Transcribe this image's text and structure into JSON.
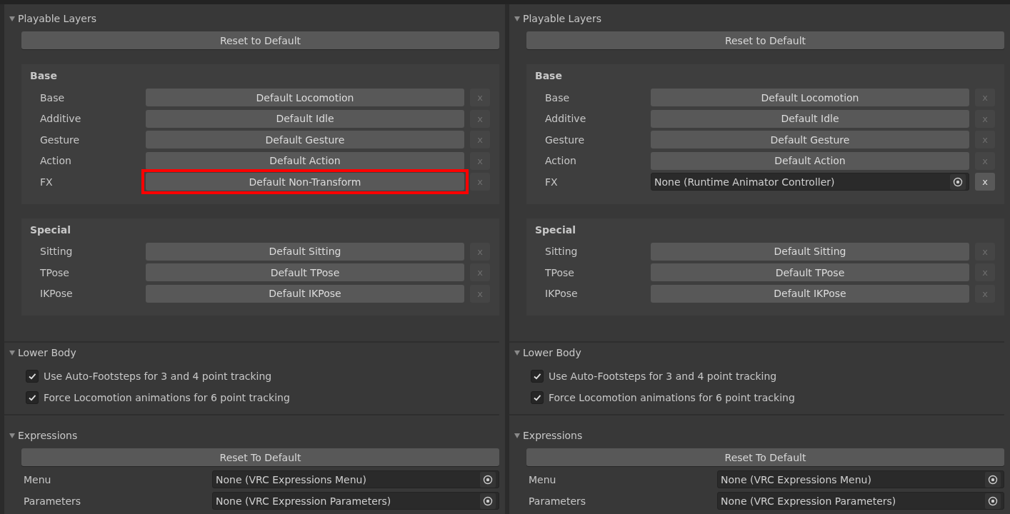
{
  "panels": [
    {
      "playable_layers": {
        "title": "Playable Layers",
        "expanded": true,
        "reset_button": "Reset to Default",
        "groups": [
          {
            "title": "Base",
            "layers": [
              {
                "label": "Base",
                "kind": "default",
                "value": "Default Locomotion",
                "clear_button": "x",
                "clear_enabled": false,
                "highlighted": false
              },
              {
                "label": "Additive",
                "kind": "default",
                "value": "Default Idle",
                "clear_button": "x",
                "clear_enabled": false,
                "highlighted": false
              },
              {
                "label": "Gesture",
                "kind": "default",
                "value": "Default Gesture",
                "clear_button": "x",
                "clear_enabled": false,
                "highlighted": false
              },
              {
                "label": "Action",
                "kind": "default",
                "value": "Default Action",
                "clear_button": "x",
                "clear_enabled": false,
                "highlighted": false
              },
              {
                "label": "FX",
                "kind": "default",
                "value": "Default Non-Transform",
                "clear_button": "x",
                "clear_enabled": false,
                "highlighted": true
              }
            ]
          },
          {
            "title": "Special",
            "layers": [
              {
                "label": "Sitting",
                "kind": "default",
                "value": "Default Sitting",
                "clear_button": "x",
                "clear_enabled": false,
                "highlighted": false
              },
              {
                "label": "TPose",
                "kind": "default",
                "value": "Default TPose",
                "clear_button": "x",
                "clear_enabled": false,
                "highlighted": false
              },
              {
                "label": "IKPose",
                "kind": "default",
                "value": "Default IKPose",
                "clear_button": "x",
                "clear_enabled": false,
                "highlighted": false
              }
            ]
          }
        ]
      },
      "lower_body": {
        "title": "Lower Body",
        "expanded": true,
        "options": [
          {
            "label": "Use Auto-Footsteps for 3 and 4 point tracking",
            "checked": true
          },
          {
            "label": "Force Locomotion animations for 6 point tracking",
            "checked": true
          }
        ]
      },
      "expressions": {
        "title": "Expressions",
        "expanded": true,
        "reset_button": "Reset To Default",
        "fields": [
          {
            "label": "Menu",
            "value": "None (VRC Expressions Menu)"
          },
          {
            "label": "Parameters",
            "value": "None (VRC Expression Parameters)"
          }
        ]
      }
    },
    {
      "playable_layers": {
        "title": "Playable Layers",
        "expanded": true,
        "reset_button": "Reset to Default",
        "groups": [
          {
            "title": "Base",
            "layers": [
              {
                "label": "Base",
                "kind": "default",
                "value": "Default Locomotion",
                "clear_button": "x",
                "clear_enabled": false,
                "highlighted": false
              },
              {
                "label": "Additive",
                "kind": "default",
                "value": "Default Idle",
                "clear_button": "x",
                "clear_enabled": false,
                "highlighted": false
              },
              {
                "label": "Gesture",
                "kind": "default",
                "value": "Default Gesture",
                "clear_button": "x",
                "clear_enabled": false,
                "highlighted": false
              },
              {
                "label": "Action",
                "kind": "default",
                "value": "Default Action",
                "clear_button": "x",
                "clear_enabled": false,
                "highlighted": false
              },
              {
                "label": "FX",
                "kind": "object",
                "value": "None (Runtime Animator Controller)",
                "clear_button": "x",
                "clear_enabled": true,
                "highlighted": false
              }
            ]
          },
          {
            "title": "Special",
            "layers": [
              {
                "label": "Sitting",
                "kind": "default",
                "value": "Default Sitting",
                "clear_button": "x",
                "clear_enabled": false,
                "highlighted": false
              },
              {
                "label": "TPose",
                "kind": "default",
                "value": "Default TPose",
                "clear_button": "x",
                "clear_enabled": false,
                "highlighted": false
              },
              {
                "label": "IKPose",
                "kind": "default",
                "value": "Default IKPose",
                "clear_button": "x",
                "clear_enabled": false,
                "highlighted": false
              }
            ]
          }
        ]
      },
      "lower_body": {
        "title": "Lower Body",
        "expanded": true,
        "options": [
          {
            "label": "Use Auto-Footsteps for 3 and 4 point tracking",
            "checked": true
          },
          {
            "label": "Force Locomotion animations for 6 point tracking",
            "checked": true
          }
        ]
      },
      "expressions": {
        "title": "Expressions",
        "expanded": true,
        "reset_button": "Reset To Default",
        "fields": [
          {
            "label": "Menu",
            "value": "None (VRC Expressions Menu)"
          },
          {
            "label": "Parameters",
            "value": "None (VRC Expression Parameters)"
          }
        ]
      }
    }
  ]
}
